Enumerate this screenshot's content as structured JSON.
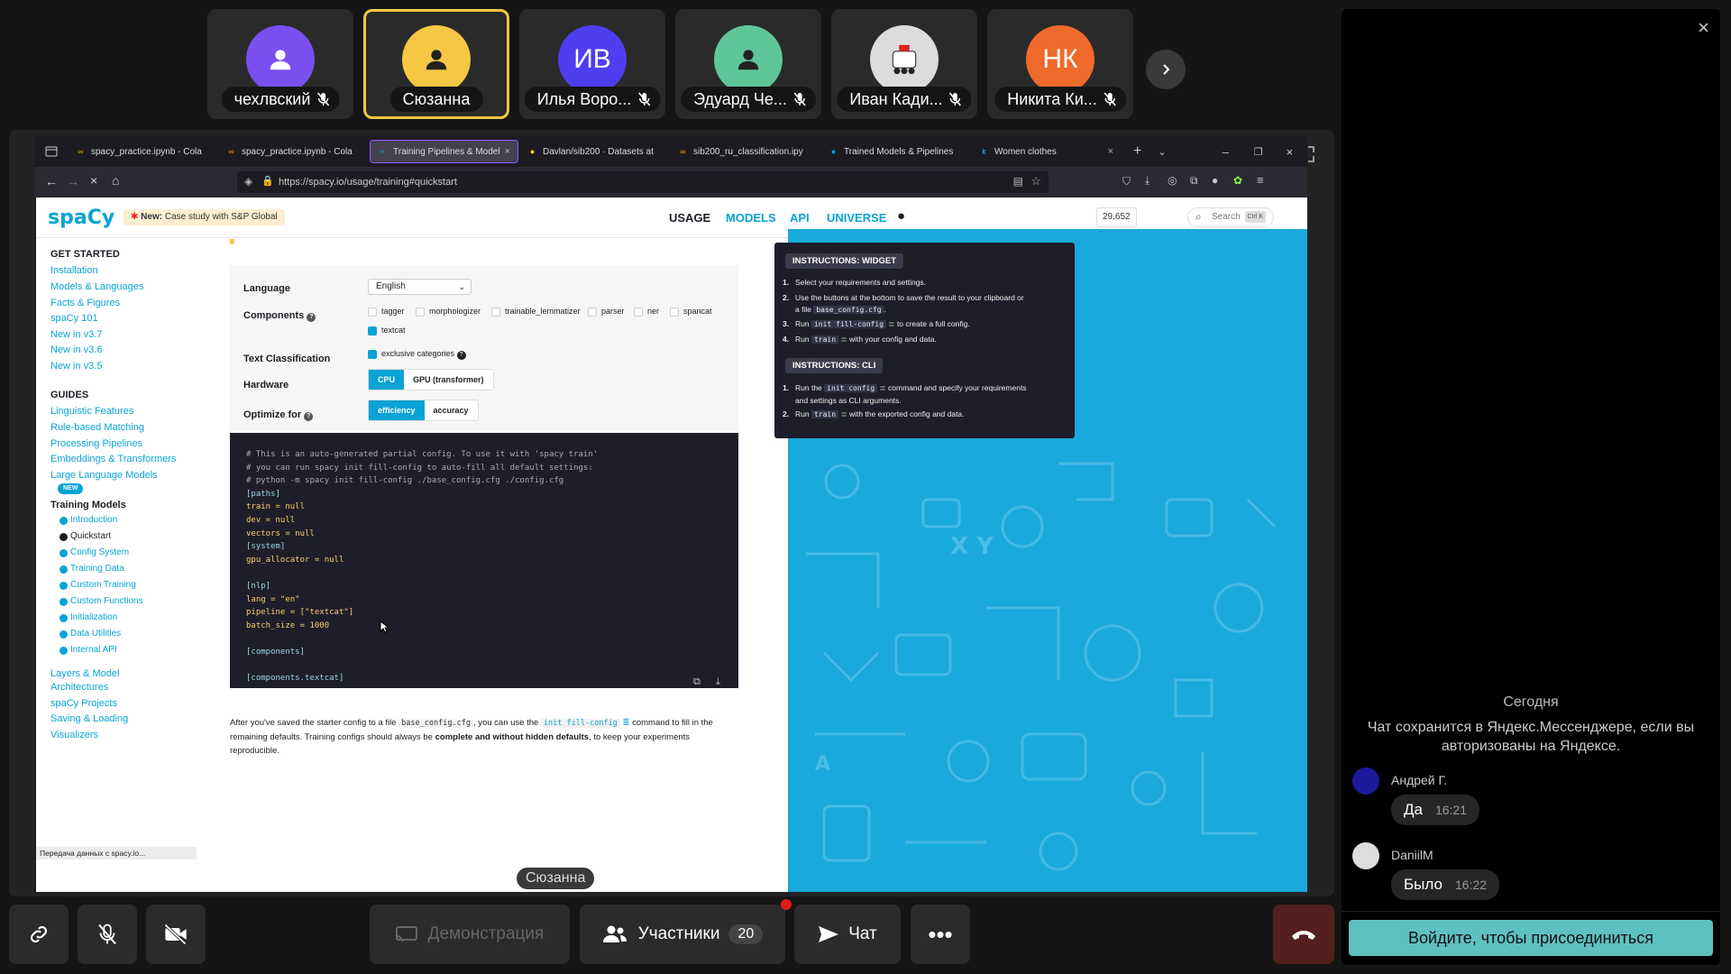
{
  "participants": [
    {
      "name": "чехлвский",
      "initials": "",
      "color": "#7a4ff0"
    },
    {
      "name": "Сюзанна",
      "initials": "",
      "color": "#f5c742"
    },
    {
      "name": "Илья Воро...",
      "initials": "ИВ",
      "color": "#4d3ef0"
    },
    {
      "name": "Эдуард Че...",
      "initials": "",
      "color": "#5fc69a"
    },
    {
      "name": "Иван Кади...",
      "initials": "",
      "color": "#dcdcdc"
    },
    {
      "name": "Никита Ки...",
      "initials": "НК",
      "color": "#f06a2b"
    }
  ],
  "browser": {
    "tabs": [
      "spacy_practice.ipynb - Cola",
      "spacy_practice.ipynb - Cola",
      "Training Pipelines & Model",
      "Davlan/sib200 · Datasets at",
      "sib200_ru_classification.ipy",
      "Trained Models & Pipelines",
      "Women clothes"
    ],
    "url": "https://spacy.io/usage/training#quickstart",
    "status": "Передача данных с spacy.io..."
  },
  "site": {
    "logo": "spaCy",
    "banner_new": "New:",
    "banner_text": "Case study with S&P Global",
    "nav": [
      "USAGE",
      "MODELS",
      "API",
      "UNIVERSE"
    ],
    "stars": "29,652",
    "search_placeholder": "Search",
    "search_kbd": "Ctrl K"
  },
  "sidebar": {
    "get_started": "GET STARTED",
    "get_started_links": [
      "Installation",
      "Models & Languages",
      "Facts & Figures",
      "spaCy 101",
      "New in v3.7",
      "New in v3.6",
      "New in v3.5"
    ],
    "guides": "GUIDES",
    "guides_links": [
      "Linguistic Features",
      "Rule-based Matching",
      "Processing Pipelines",
      "Embeddings & Transformers",
      "Large Language Models"
    ],
    "new_badge": "NEW",
    "current": "Training Models",
    "sub_links": [
      "Introduction",
      "Quickstart",
      "Config System",
      "Training Data",
      "Custom Training",
      "Custom Functions",
      "Initialization",
      "Data Utilities",
      "Internal API"
    ],
    "more_links": [
      "Layers & Model",
      "Architectures",
      "spaCy Projects",
      "Saving & Loading",
      "Visualizers"
    ]
  },
  "widget": {
    "language_label": "Language",
    "language_value": "English",
    "components_label": "Components",
    "components": [
      "tagger",
      "morphologizer",
      "trainable_lemmatizer",
      "parser",
      "ner",
      "spancat"
    ],
    "textcat": "textcat",
    "textclass_label": "Text Classification",
    "exclusive": "exclusive categories",
    "hardware_label": "Hardware",
    "hardware": [
      "CPU",
      "GPU (transformer)"
    ],
    "optimize_label": "Optimize for",
    "optimize": [
      "efficiency",
      "accuracy"
    ]
  },
  "config_code": [
    {
      "t": "# This is an auto-generated partial config. To use it with 'spacy train'",
      "k": "c"
    },
    {
      "t": "# you can run spacy init fill-config to auto-fill all default settings:",
      "k": "c"
    },
    {
      "t": "# python -m spacy init fill-config ./base_config.cfg ./config.cfg",
      "k": "c"
    },
    {
      "t": "[paths]",
      "k": "s"
    },
    {
      "t": "train = null",
      "k": "v"
    },
    {
      "t": "dev = null",
      "k": "v"
    },
    {
      "t": "vectors = null",
      "k": "v"
    },
    {
      "t": "[system]",
      "k": "s"
    },
    {
      "t": "gpu_allocator = null",
      "k": "v"
    },
    {
      "t": "",
      "k": "v"
    },
    {
      "t": "[nlp]",
      "k": "s"
    },
    {
      "t": "lang = \"en\"",
      "k": "v"
    },
    {
      "t": "pipeline = [\"textcat\"]",
      "k": "v"
    },
    {
      "t": "batch_size = 1000",
      "k": "v"
    },
    {
      "t": "",
      "k": "v"
    },
    {
      "t": "[components]",
      "k": "s"
    },
    {
      "t": "",
      "k": "v"
    },
    {
      "t": "[components.textcat]",
      "k": "s"
    }
  ],
  "after": {
    "p1": "After you've saved the starter config to a file",
    "file": "base_config.cfg",
    "p2": ", you can use the",
    "cmd": "init fill-config",
    "p3": "command to fill in the remaining defaults. Training configs should always be",
    "bold": "complete and without hidden defaults",
    "p4": ", to keep your experiments reproducible."
  },
  "instructions": {
    "widget_title": "INSTRUCTIONS: WIDGET",
    "w1": "Select your requirements and settings.",
    "w2a": "Use the buttons at the bottom to save the result to your clipboard or",
    "w2b": "a file",
    "w2file": "base_config.cfg",
    "w3a": "Run",
    "w3code": "init fill-config",
    "w3b": "to create a full config.",
    "w4a": "Run",
    "w4code": "train",
    "w4b": "with your config and data.",
    "cli_title": "INSTRUCTIONS: CLI",
    "c1a": "Run the",
    "c1code": "init config",
    "c1b": "command and specify your requirements",
    "c1c": "and settings as CLI arguments.",
    "c2a": "Run",
    "c2code": "train",
    "c2b": "with the exported config and data."
  },
  "speaker": "Сюзанна",
  "toolbar": {
    "demo": "Демонстрация",
    "participants": "Участники",
    "participants_count": "20",
    "chat": "Чат"
  },
  "chat": {
    "today": "Сегодня",
    "note": "Чат сохранится в Яндекс.Мессенджере, если вы авторизованы на Яндексе.",
    "messages": [
      {
        "author": "Андрей Г.",
        "text": "Да",
        "time": "16:21"
      },
      {
        "author": "DaniilM",
        "text": "Было",
        "time": "16:22"
      }
    ],
    "join": "Войдите, чтобы присоединиться"
  }
}
